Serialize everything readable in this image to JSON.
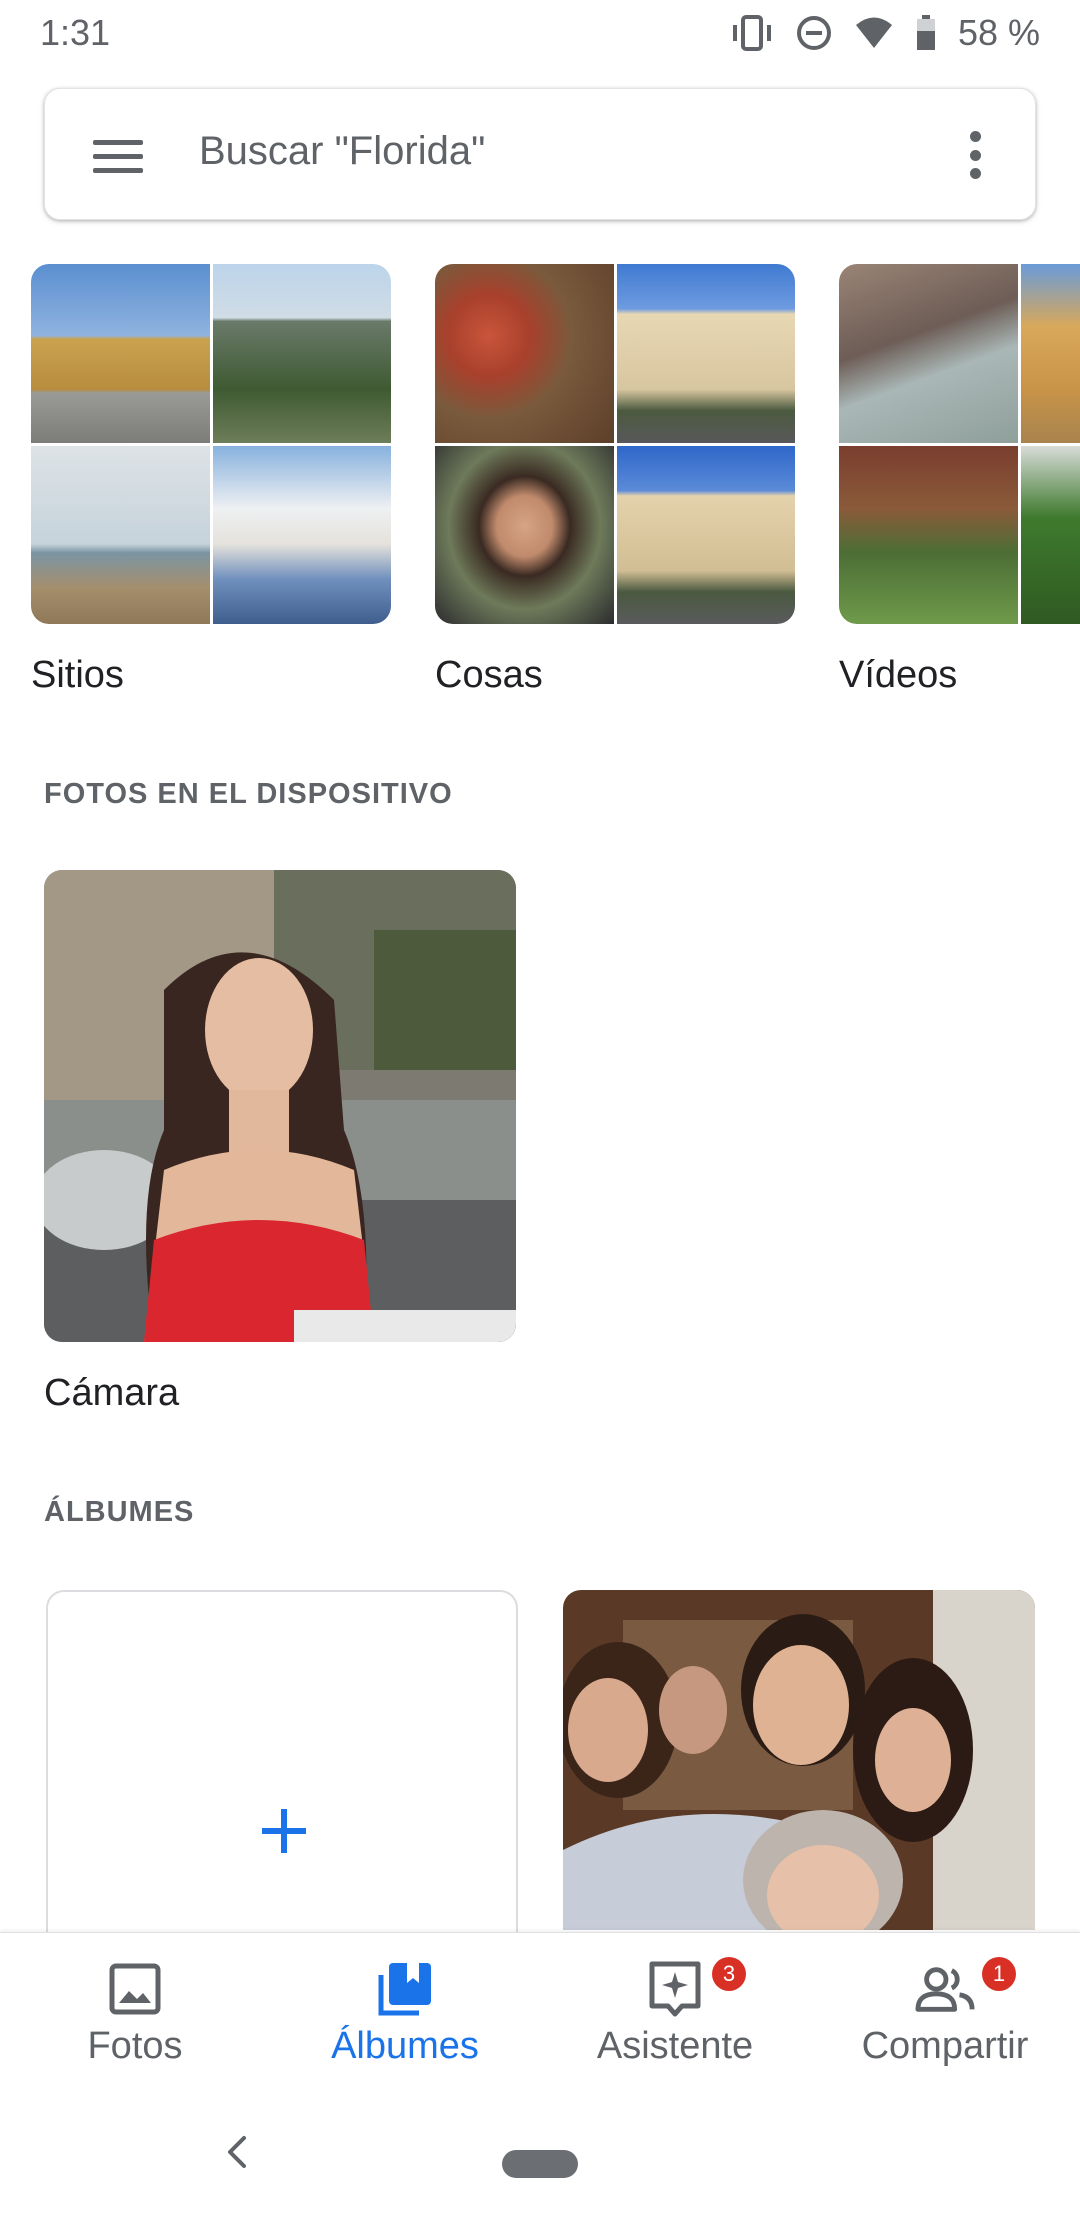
{
  "status_bar": {
    "time": "1:31",
    "battery": "58 %"
  },
  "search": {
    "placeholder": "Buscar \"Florida\""
  },
  "categories": [
    {
      "label": "Sitios"
    },
    {
      "label": "Cosas"
    },
    {
      "label": "Vídeos"
    }
  ],
  "device_section": {
    "header": "FOTOS EN EL DISPOSITIVO",
    "folder_label": "Cámara"
  },
  "albums_section": {
    "header": "ÁLBUMES"
  },
  "nav": {
    "items": [
      {
        "label": "Fotos",
        "icon": "photo-icon"
      },
      {
        "label": "Álbumes",
        "icon": "albums-icon"
      },
      {
        "label": "Asistente",
        "icon": "assistant-icon",
        "badge": "3"
      },
      {
        "label": "Compartir",
        "icon": "people-icon",
        "badge": "1"
      }
    ]
  },
  "colors": {
    "accent": "#1a73e8",
    "badge": "#d93025",
    "muted": "#5f6368"
  }
}
